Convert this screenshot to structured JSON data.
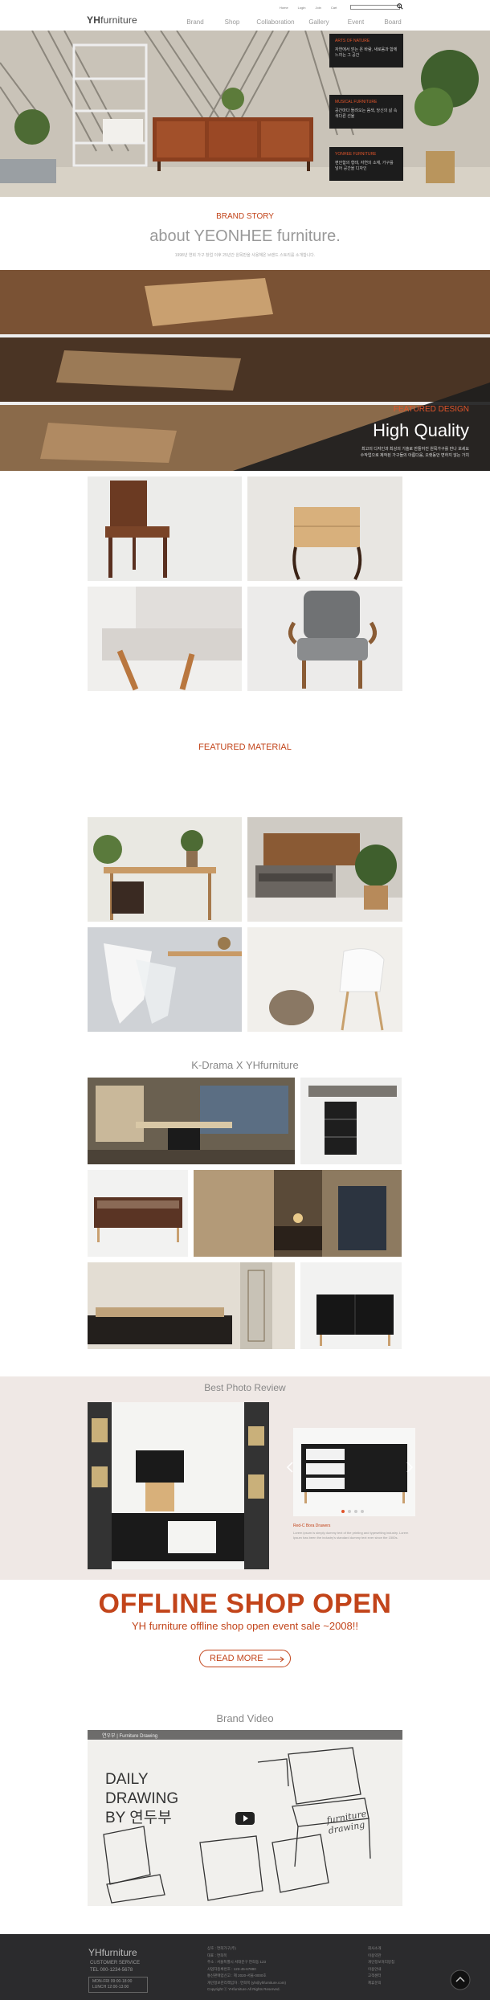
{
  "header": {
    "logo_prefix": "YH",
    "logo_suffix": "furniture",
    "util_links": [
      "Home",
      "Login",
      "Join",
      "Cart"
    ],
    "search_placeholder": "",
    "nav": [
      "Brand",
      "Shop",
      "Collaboration",
      "Gallery",
      "Event",
      "Board"
    ]
  },
  "hero": {
    "panels": [
      {
        "title": "ARTS OF NATURE",
        "desc": "자연에서 얻는 온 바람, 새로움과 함께 느끼는 그 공간"
      },
      {
        "title": "MUSICAL FURNITURE",
        "desc": "공간마다 들려오는 음색, 당신의 삶 속 색다른 선율"
      },
      {
        "title": "YONHEE FURNITURE",
        "desc": "편안함의 형태, 자연의 소재, 가구를 넘어 공간을 디자인"
      }
    ]
  },
  "brand_story": {
    "label": "BRAND STORY",
    "title": "about YEONHEE furniture.",
    "note": "1998년 연희 가구 창업 이후 25년간 원목만을 사용해온 브랜드 스토리를 소개합니다."
  },
  "featured_design": {
    "label": "FEATURED DESIGN",
    "title": "High Quality",
    "desc_line1": "최고의 디자인과 최상의 기술로 만들어진 원목가구를 만나 보세요",
    "desc_line2": "수작업으로 제작된 가구들의 아름다움, 오랫동안 변하지 않는 가치"
  },
  "featured_material": {
    "label": "FEATURED MATERIAL"
  },
  "kdrama": {
    "title": "K-Drama X YHfurniture"
  },
  "review": {
    "title": "Best Photo Review",
    "product_name": "Red-C Bora Drawers",
    "product_desc": "Lorem ipsum is simply dummy text of the printing and typesetting industry. Lorem Ipsum has been the industry's standard dummy text ever since the 1500s."
  },
  "offline": {
    "title": "OFFLINE SHOP OPEN",
    "subtitle": "YH furniture offline shop open event sale ~2008!!",
    "read_more": "READ MORE"
  },
  "video": {
    "section_title": "Brand Video",
    "channel_title": "연우부 | Furniture Drawing",
    "line1": "DAILY",
    "line2": "DRAWING",
    "line3": "BY 연두부",
    "signature": "furniture drawing"
  },
  "footer": {
    "logo": "YHfurniture",
    "service_title": "CUSTOMER SERVICE",
    "tel": "TEL 000-1234-5678",
    "hours_1": "MON-FRI  09:00-18:00",
    "hours_2": "LUNCH  12:00-13:00",
    "info": [
      "상호 : 연희가구(주)",
      "대표 : 연희목",
      "주소 : 서울특별시 서대문구 연희동 123",
      "사업자등록번호 : 123-45-67890",
      "통신판매업신고 : 제 2020-서울-0000호",
      "개인정보관리책임자 : 연희목 (yh@yhfurniture.com)",
      "Copyright ⓒ YHfurniture All Rights Reserved."
    ],
    "links": [
      "회사소개",
      "이용약관",
      "개인정보처리방침",
      "이용안내",
      "고객센터",
      "제휴문의"
    ]
  },
  "colors": {
    "accent": "#c2441a",
    "footer_bg": "#2b2b2d",
    "review_bg": "#efe8e5",
    "hero_panel_bg": "#1c1c1c"
  }
}
